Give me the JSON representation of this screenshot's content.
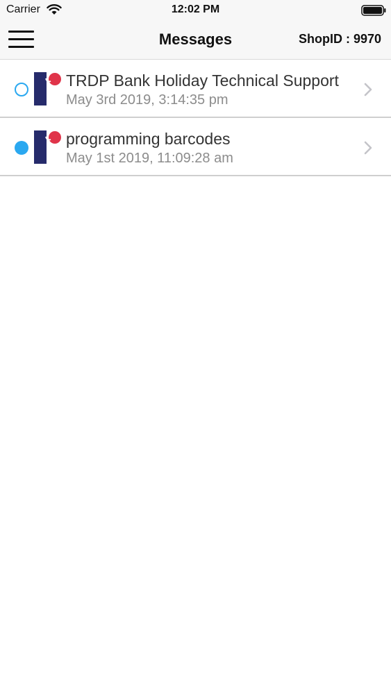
{
  "status_bar": {
    "carrier": "Carrier",
    "time": "12:02 PM"
  },
  "nav": {
    "title": "Messages",
    "shop_id": "ShopID : 9970",
    "menu_icon": "hamburger-menu-icon"
  },
  "colors": {
    "accent": "#2aa8f0",
    "logo_navy": "#262b6b",
    "logo_red": "#e0344a",
    "date_gray": "#8c8c8c"
  },
  "messages": [
    {
      "title": "TRDP Bank Holiday Technical Support",
      "date": "May 3rd 2019, 3:14:35 pm",
      "read": true
    },
    {
      "title": "programming barcodes",
      "date": "May 1st 2019, 11:09:28 am",
      "read": false
    }
  ]
}
